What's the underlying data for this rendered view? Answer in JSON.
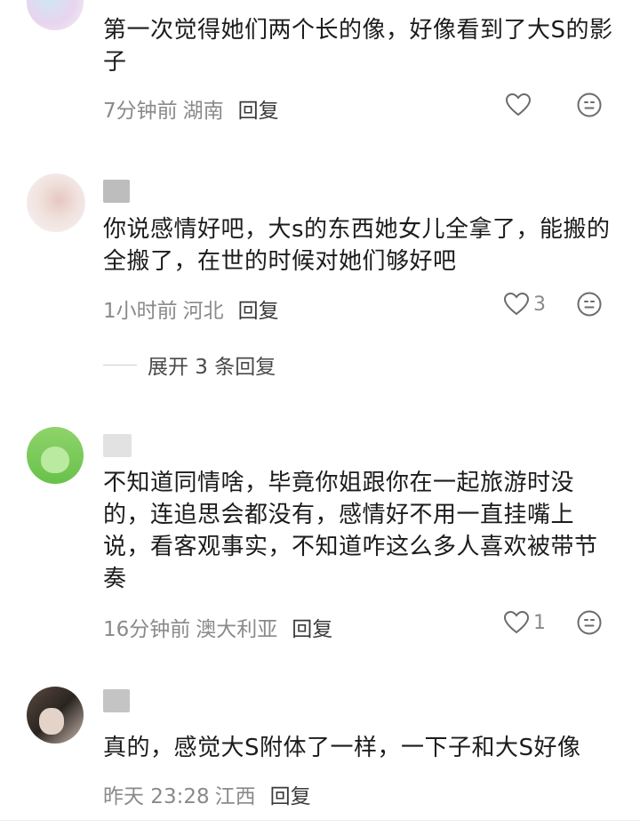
{
  "comments": [
    {
      "text": "第一次觉得她们两个长的像，好像看到了大S的影子",
      "time": "7分钟前",
      "location": "湖南",
      "reply_label": "回复",
      "likes": ""
    },
    {
      "text": "你说感情好吧，大s的东西她女儿全拿了，能搬的全搬了，在世的时候对她们够好吧",
      "time": "1小时前",
      "location": "河北",
      "reply_label": "回复",
      "likes": "3",
      "expand_label": "展开 3 条回复"
    },
    {
      "text": "不知道同情啥，毕竟你姐跟你在一起旅游时没的，连追思会都没有，感情好不用一直挂嘴上说，看客观事实，不知道咋这么多人喜欢被带节奏",
      "time": "16分钟前",
      "location": "澳大利亚",
      "reply_label": "回复",
      "likes": "1"
    },
    {
      "text": "真的，感觉大S附体了一样，一下子和大S好像",
      "time": "昨天 23:28",
      "location": "江西",
      "reply_label": "回复",
      "likes": ""
    }
  ],
  "icons": {
    "like": "heart-outline-icon",
    "emoji": "emoji-face-icon"
  },
  "colors": {
    "text": "#1c1c1c",
    "meta": "#8a8a8a",
    "reply": "#3a3a3a"
  }
}
